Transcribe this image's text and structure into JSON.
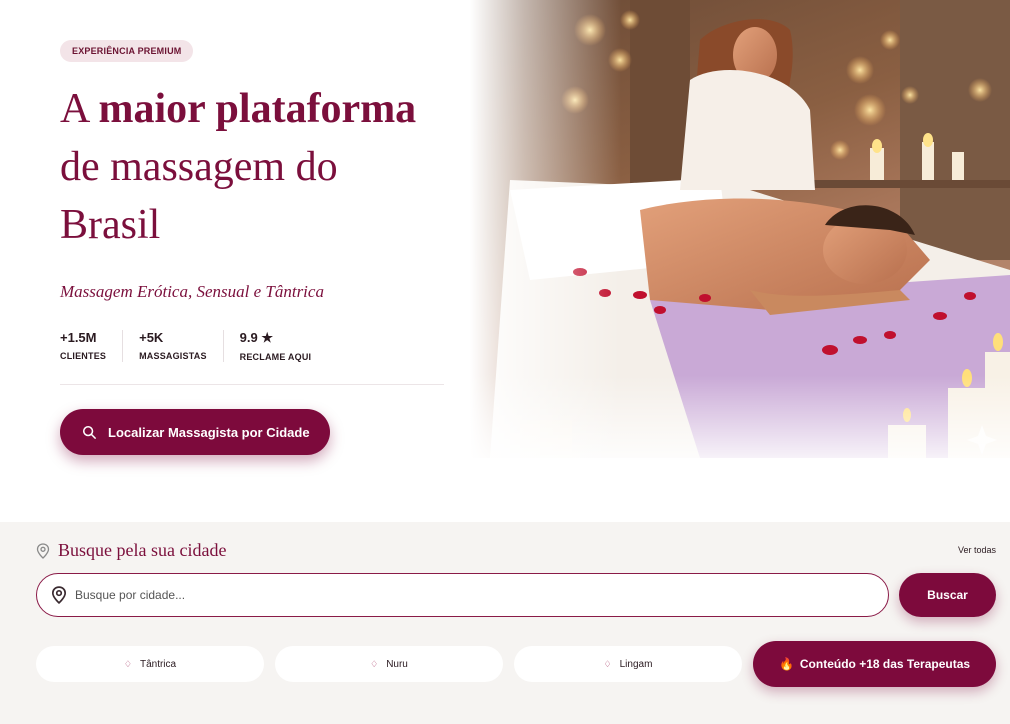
{
  "hero": {
    "badge": "EXPERIÊNCIA PREMIUM",
    "headline_pre": "A ",
    "headline_bold": "maior plataforma",
    "headline_line2": "de massagem do",
    "headline_line3": "Brasil",
    "subline": "Massagem Erótica, Sensual e Tântrica",
    "stats": [
      {
        "value": "+1.5M",
        "label": "CLIENTES"
      },
      {
        "value": "+5K",
        "label": "MASSAGISTAS"
      },
      {
        "value": "9.9 ★",
        "label": "RECLAME AQUI"
      }
    ],
    "cta_label": "Localizar Massagista por Cidade",
    "image_icon": "massage-photo"
  },
  "search": {
    "title": "Busque pela sua cidade",
    "see_all": "Ver todas",
    "placeholder": "Busque por cidade...",
    "button": "Buscar",
    "chips": [
      {
        "label": "Tântrica"
      },
      {
        "label": "Nuru"
      },
      {
        "label": "Lingam"
      }
    ],
    "hot_chip": {
      "emoji": "🔥",
      "label": "Conteúdo +18 das Terapeutas"
    }
  },
  "colors": {
    "brand": "#7d0a3c",
    "badge_bg": "#f3e4e8",
    "section_bg": "#f6f4f2"
  }
}
